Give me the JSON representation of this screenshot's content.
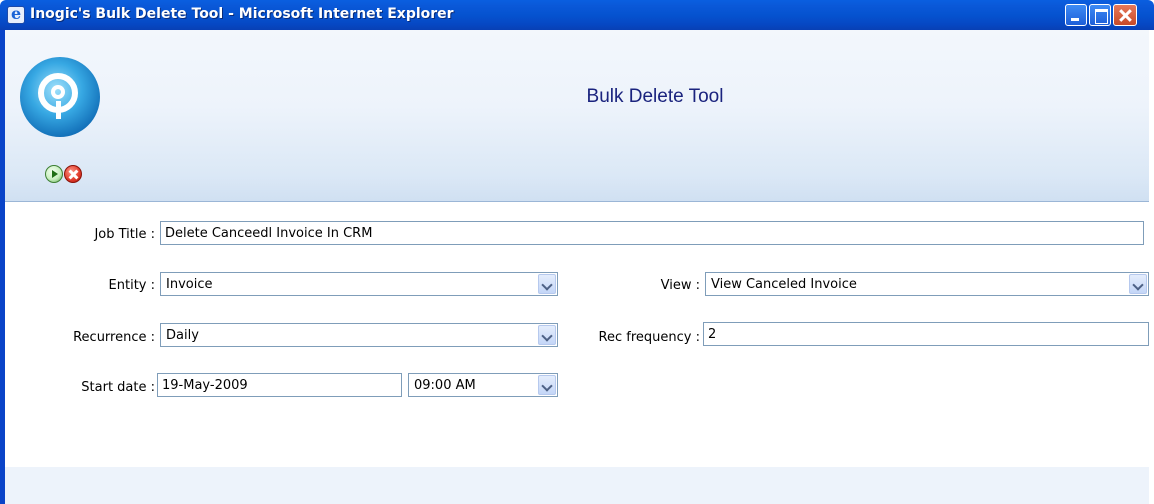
{
  "window": {
    "title": "Inogic's Bulk Delete Tool - Microsoft Internet Explorer"
  },
  "header": {
    "title": "Bulk Delete Tool"
  },
  "toolbar": {
    "run_icon": "run-icon",
    "cancel_icon": "cancel-icon"
  },
  "form": {
    "job_title": {
      "label": "Job Title :",
      "value": "Delete Canceedl Invoice In CRM"
    },
    "entity": {
      "label": "Entity :",
      "value": "Invoice"
    },
    "view": {
      "label": "View :",
      "value": "View Canceled Invoice"
    },
    "recurrence": {
      "label": "Recurrence :",
      "value": "Daily"
    },
    "rec_frequency": {
      "label": "Rec frequency :",
      "value": "2"
    },
    "start_date": {
      "label": "Start date :",
      "value": "19-May-2009"
    },
    "start_time": {
      "value": "09:00 AM"
    }
  },
  "colors": {
    "title_bar": "#0553d0",
    "header_title": "#1a237e",
    "field_border": "#7f9db9"
  }
}
